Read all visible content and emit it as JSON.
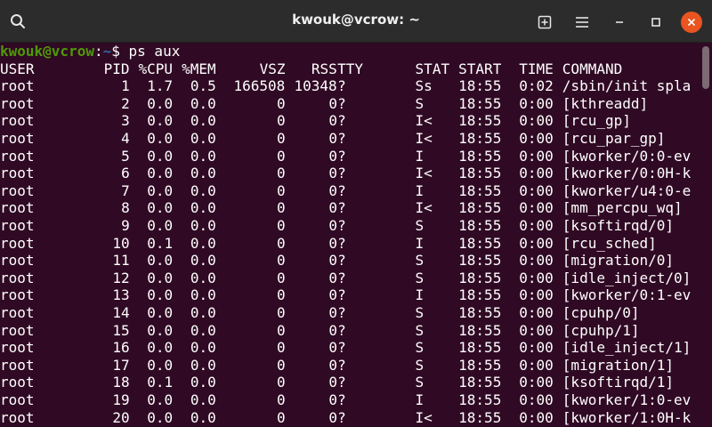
{
  "window": {
    "title": "kwouk@vcrow: ~",
    "icons": {
      "search": "search-icon",
      "new_tab": "new-tab-icon",
      "menu": "hamburger-menu-icon",
      "minimize": "minimize-icon",
      "maximize": "maximize-icon",
      "close": "close-icon"
    },
    "accent_close": "#e95420"
  },
  "terminal": {
    "prompt": {
      "user_host": "kwouk@vcrow",
      "sep": ":",
      "path": "~",
      "symbol": "$",
      "command": "ps aux"
    },
    "header": [
      "USER",
      "PID",
      "%CPU",
      "%MEM",
      "VSZ",
      "RSS",
      "TTY",
      "STAT",
      "START",
      "TIME",
      "COMMAND"
    ],
    "rows": [
      [
        "root",
        "1",
        "1.7",
        "0.5",
        "166508",
        "10348",
        "?",
        "Ss",
        "18:55",
        "0:02",
        "/sbin/init spla"
      ],
      [
        "root",
        "2",
        "0.0",
        "0.0",
        "0",
        "0",
        "?",
        "S",
        "18:55",
        "0:00",
        "[kthreadd]"
      ],
      [
        "root",
        "3",
        "0.0",
        "0.0",
        "0",
        "0",
        "?",
        "I<",
        "18:55",
        "0:00",
        "[rcu_gp]"
      ],
      [
        "root",
        "4",
        "0.0",
        "0.0",
        "0",
        "0",
        "?",
        "I<",
        "18:55",
        "0:00",
        "[rcu_par_gp]"
      ],
      [
        "root",
        "5",
        "0.0",
        "0.0",
        "0",
        "0",
        "?",
        "I",
        "18:55",
        "0:00",
        "[kworker/0:0-ev"
      ],
      [
        "root",
        "6",
        "0.0",
        "0.0",
        "0",
        "0",
        "?",
        "I<",
        "18:55",
        "0:00",
        "[kworker/0:0H-k"
      ],
      [
        "root",
        "7",
        "0.0",
        "0.0",
        "0",
        "0",
        "?",
        "I",
        "18:55",
        "0:00",
        "[kworker/u4:0-e"
      ],
      [
        "root",
        "8",
        "0.0",
        "0.0",
        "0",
        "0",
        "?",
        "I<",
        "18:55",
        "0:00",
        "[mm_percpu_wq]"
      ],
      [
        "root",
        "9",
        "0.0",
        "0.0",
        "0",
        "0",
        "?",
        "S",
        "18:55",
        "0:00",
        "[ksoftirqd/0]"
      ],
      [
        "root",
        "10",
        "0.1",
        "0.0",
        "0",
        "0",
        "?",
        "I",
        "18:55",
        "0:00",
        "[rcu_sched]"
      ],
      [
        "root",
        "11",
        "0.0",
        "0.0",
        "0",
        "0",
        "?",
        "S",
        "18:55",
        "0:00",
        "[migration/0]"
      ],
      [
        "root",
        "12",
        "0.0",
        "0.0",
        "0",
        "0",
        "?",
        "S",
        "18:55",
        "0:00",
        "[idle_inject/0]"
      ],
      [
        "root",
        "13",
        "0.0",
        "0.0",
        "0",
        "0",
        "?",
        "I",
        "18:55",
        "0:00",
        "[kworker/0:1-ev"
      ],
      [
        "root",
        "14",
        "0.0",
        "0.0",
        "0",
        "0",
        "?",
        "S",
        "18:55",
        "0:00",
        "[cpuhp/0]"
      ],
      [
        "root",
        "15",
        "0.0",
        "0.0",
        "0",
        "0",
        "?",
        "S",
        "18:55",
        "0:00",
        "[cpuhp/1]"
      ],
      [
        "root",
        "16",
        "0.0",
        "0.0",
        "0",
        "0",
        "?",
        "S",
        "18:55",
        "0:00",
        "[idle_inject/1]"
      ],
      [
        "root",
        "17",
        "0.0",
        "0.0",
        "0",
        "0",
        "?",
        "S",
        "18:55",
        "0:00",
        "[migration/1]"
      ],
      [
        "root",
        "18",
        "0.1",
        "0.0",
        "0",
        "0",
        "?",
        "S",
        "18:55",
        "0:00",
        "[ksoftirqd/1]"
      ],
      [
        "root",
        "19",
        "0.0",
        "0.0",
        "0",
        "0",
        "?",
        "I",
        "18:55",
        "0:00",
        "[kworker/1:0-ev"
      ],
      [
        "root",
        "20",
        "0.0",
        "0.0",
        "0",
        "0",
        "?",
        "I<",
        "18:55",
        "0:00",
        "[kworker/1:0H-k"
      ]
    ],
    "colors": {
      "background": "#300a24",
      "text": "#ffffff",
      "prompt_user": "#4e9a06",
      "prompt_path": "#3465a4"
    }
  }
}
